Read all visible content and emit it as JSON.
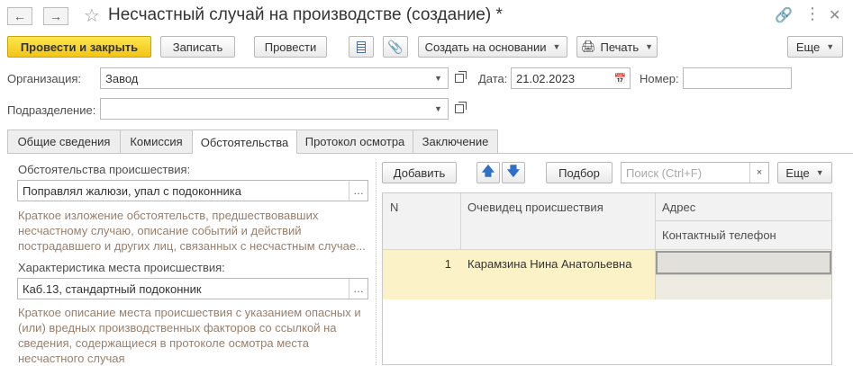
{
  "window": {
    "title": "Несчастный случай на производстве (создание) *"
  },
  "toolbar": {
    "post_and_close": "Провести и закрыть",
    "save": "Записать",
    "post": "Провести",
    "create_based_on": "Создать на основании",
    "print": "Печать",
    "more": "Еще"
  },
  "form": {
    "organization_label": "Организация:",
    "organization_value": "Завод",
    "date_label": "Дата:",
    "date_value": "21.02.2023",
    "number_label": "Номер:",
    "number_value": "",
    "division_label": "Подразделение:",
    "division_value": ""
  },
  "tabs": [
    {
      "label": "Общие сведения"
    },
    {
      "label": "Комиссия"
    },
    {
      "label": "Обстоятельства"
    },
    {
      "label": "Протокол осмотра"
    },
    {
      "label": "Заключение"
    }
  ],
  "circumstances": {
    "label": "Обстоятельства происшествия:",
    "value": "Поправлял жалюзи, упал с подоконника",
    "hint_lines": [
      "Краткое изложение обстоятельств, предшествовавших",
      "несчастному случаю, описание событий и действий",
      "пострадавшего и других лиц, связанных с несчастным случае..."
    ]
  },
  "place": {
    "label": "Характеристика места происшествия:",
    "value": "Каб.13, стандартный подоконник",
    "hint_lines": [
      "Краткое описание места происшествия с указанием опасных и",
      "(или) вредных производственных факторов со ссылкой на",
      "сведения, содержащиеся в протоколе осмотра места",
      "несчастного случая"
    ]
  },
  "witnesses": {
    "add_button": "Добавить",
    "select_button": "Подбор",
    "search_placeholder": "Поиск (Ctrl+F)",
    "more_button": "Еще",
    "columns": {
      "n": "N",
      "witness": "Очевидец происшествия",
      "address": "Адрес",
      "phone": "Контактный телефон"
    },
    "rows": [
      {
        "n": "1",
        "witness": "Карамзина Нина Анатольевна",
        "address": "",
        "phone": ""
      }
    ]
  },
  "colors": {
    "primary_button": "#f3c518",
    "selected_row": "#fbf2c8",
    "hint_text": "#9a7f6a"
  }
}
